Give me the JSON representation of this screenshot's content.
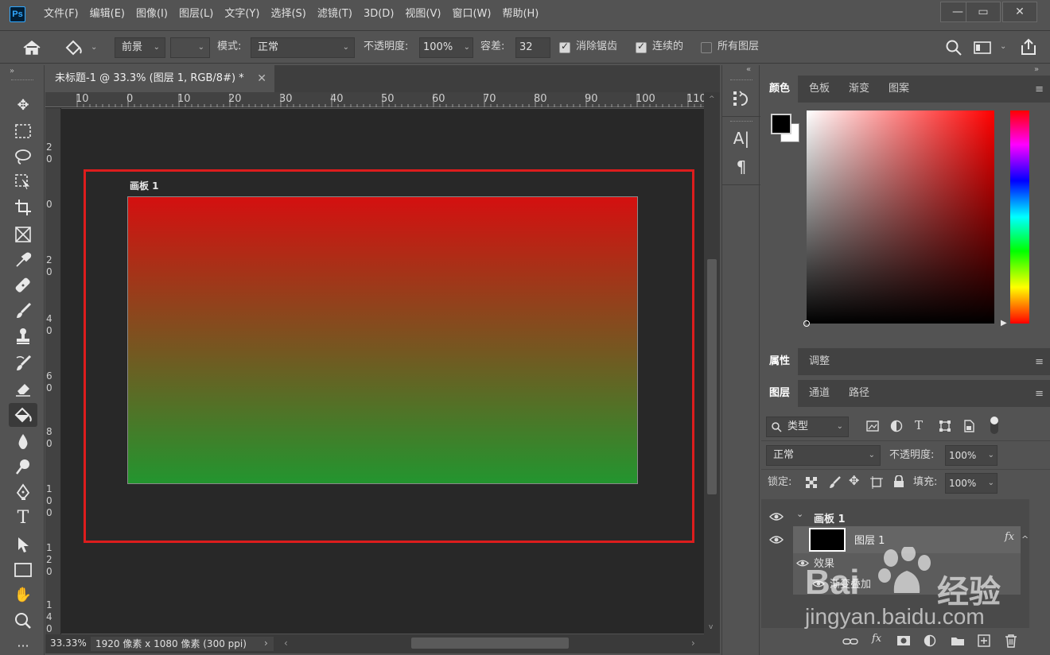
{
  "app": {
    "logo": "Ps"
  },
  "menu": [
    "文件(F)",
    "编辑(E)",
    "图像(I)",
    "图层(L)",
    "文字(Y)",
    "选择(S)",
    "滤镜(T)",
    "3D(D)",
    "视图(V)",
    "窗口(W)",
    "帮助(H)"
  ],
  "window_controls": {
    "minimize": "—",
    "restore": "▭",
    "close": "✕"
  },
  "options": {
    "fill_source": "前景",
    "mode_label": "模式:",
    "mode_value": "正常",
    "opacity_label": "不透明度:",
    "opacity_value": "100%",
    "tolerance_label": "容差:",
    "tolerance_value": "32",
    "antialias_label": "消除锯齿",
    "antialias_checked": true,
    "contiguous_label": "连续的",
    "contiguous_checked": true,
    "all_layers_label": "所有图层",
    "all_layers_checked": false
  },
  "document": {
    "tab_title": "未标题-1 @ 33.3% (图层 1, RGB/8#) *",
    "artboard_name": "画板 1",
    "gradient": {
      "top_color": "#d41010",
      "bottom_color": "#23952f"
    },
    "selection_color": "#dd1d1d"
  },
  "rulers": {
    "horizontal": [
      "10",
      "0",
      "10",
      "20",
      "30",
      "40",
      "50",
      "60",
      "70",
      "80",
      "90",
      "100",
      "110"
    ],
    "vertical": [
      [
        "2",
        "0"
      ],
      [
        "0"
      ],
      [
        "2",
        "0"
      ],
      [
        "4",
        "0"
      ],
      [
        "6",
        "0"
      ],
      [
        "8",
        "0"
      ],
      [
        "1",
        "0",
        "0"
      ],
      [
        "1",
        "2",
        "0"
      ],
      [
        "1",
        "4",
        "0"
      ]
    ]
  },
  "status": {
    "zoom": "33.33%",
    "doc_info": "1920 像素 x 1080 像素 (300 ppi)"
  },
  "color_panel": {
    "tabs": [
      "颜色",
      "色板",
      "渐变",
      "图案"
    ],
    "foreground": "#000000",
    "background": "#ffffff",
    "hue_color": "#ff0000"
  },
  "properties_panel": {
    "tabs": [
      "属性",
      "调整"
    ]
  },
  "layers_panel": {
    "tabs": [
      "图层",
      "通道",
      "路径"
    ],
    "filter_label": "类型",
    "blend_mode": "正常",
    "opacity_label": "不透明度:",
    "opacity_value": "100%",
    "lock_label": "锁定:",
    "fill_label": "填充:",
    "fill_value": "100%",
    "layers": [
      {
        "name": "画板 1",
        "type": "artboard"
      },
      {
        "name": "图层 1",
        "type": "layer",
        "fx": "fx"
      },
      {
        "name": "效果",
        "type": "effects"
      },
      {
        "name": "渐变叠加",
        "type": "effect"
      }
    ]
  },
  "watermark": {
    "text1": "Bai",
    "text2": "经验",
    "url": "jingyan.baidu.com"
  }
}
